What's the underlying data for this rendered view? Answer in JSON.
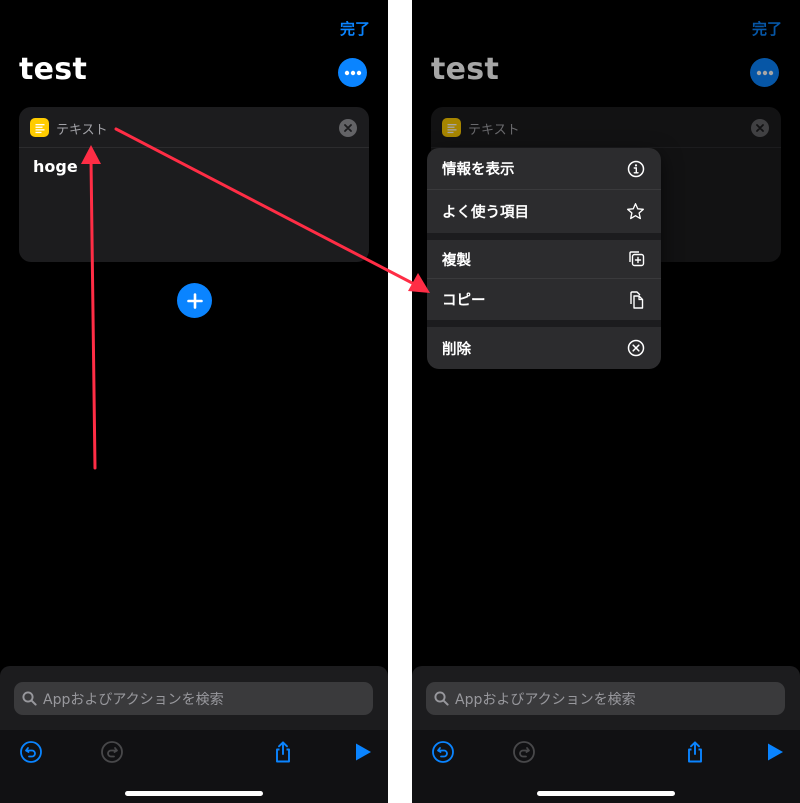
{
  "left": {
    "done_label": "完了",
    "title": "test",
    "card": {
      "title": "テキスト",
      "text": "hoge"
    },
    "search_placeholder": "Appおよびアクションを検索"
  },
  "right": {
    "done_label": "完了",
    "title": "test",
    "card": {
      "title": "テキスト"
    },
    "menu": {
      "show_info": "情報を表示",
      "favorite": "よく使う項目",
      "duplicate": "複製",
      "copy": "コピー",
      "delete": "削除"
    },
    "search_placeholder": "Appおよびアクションを検索"
  },
  "colors": {
    "accent": "#0a84ff",
    "arrow": "#ff2d45",
    "text_icon": "#ffcc00"
  }
}
